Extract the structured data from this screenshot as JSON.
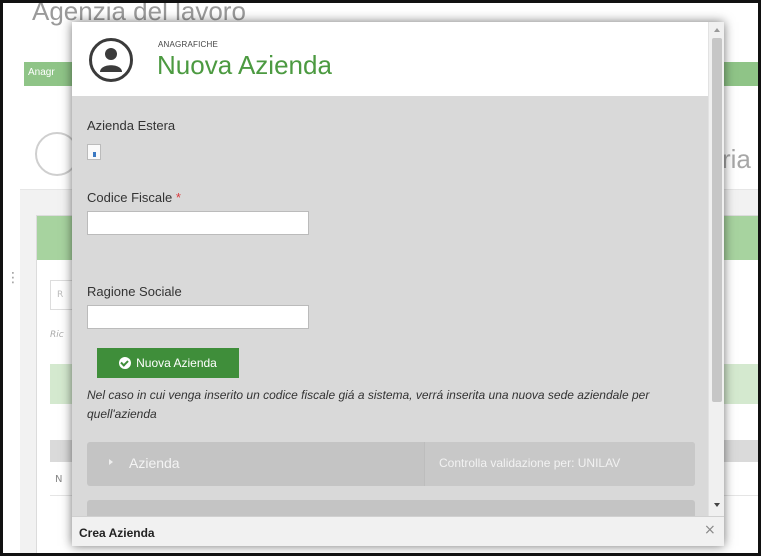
{
  "background": {
    "app_title": "Agenzia del lavoro",
    "nav_label": "Anagr",
    "right_heading_fragment": "ria",
    "search_placeholder_fragment": "R",
    "search_hint_fragment": "Ric",
    "green_row_fragment": "L",
    "table_row_fragment": "N",
    "side_dots": "⋮"
  },
  "modal": {
    "kicker": "ANAGRAFICHE",
    "title": "Nuova Azienda",
    "fields": {
      "azienda_estera_label": "Azienda Estera",
      "codice_fiscale_label": "Codice Fiscale",
      "required_mark": "*",
      "codice_fiscale_value": "",
      "ragione_sociale_label": "Ragione Sociale",
      "ragione_sociale_value": ""
    },
    "nuova_azienda_button": "Nuova Azienda",
    "note": "Nel caso in cui venga inserito un codice fiscale giá a sistema, verrá inserita una nuova sede aziendale per quell'azienda",
    "accordion": {
      "azienda_label": "Azienda",
      "validation_label": "Controlla validazione per: UNILAV"
    },
    "footer_title": "Crea Azienda",
    "close_glyph": "×"
  },
  "colors": {
    "brand_green": "#4c9a41",
    "button_green": "#3f8e3a",
    "required_red": "#d9393c",
    "modal_bg": "#d9d9d9"
  },
  "icons": {
    "avatar": "user-avatar-icon",
    "button": "check-circle-icon",
    "accordion": "caret-right-icon",
    "close": "close-icon",
    "background": "pencil-icon"
  }
}
